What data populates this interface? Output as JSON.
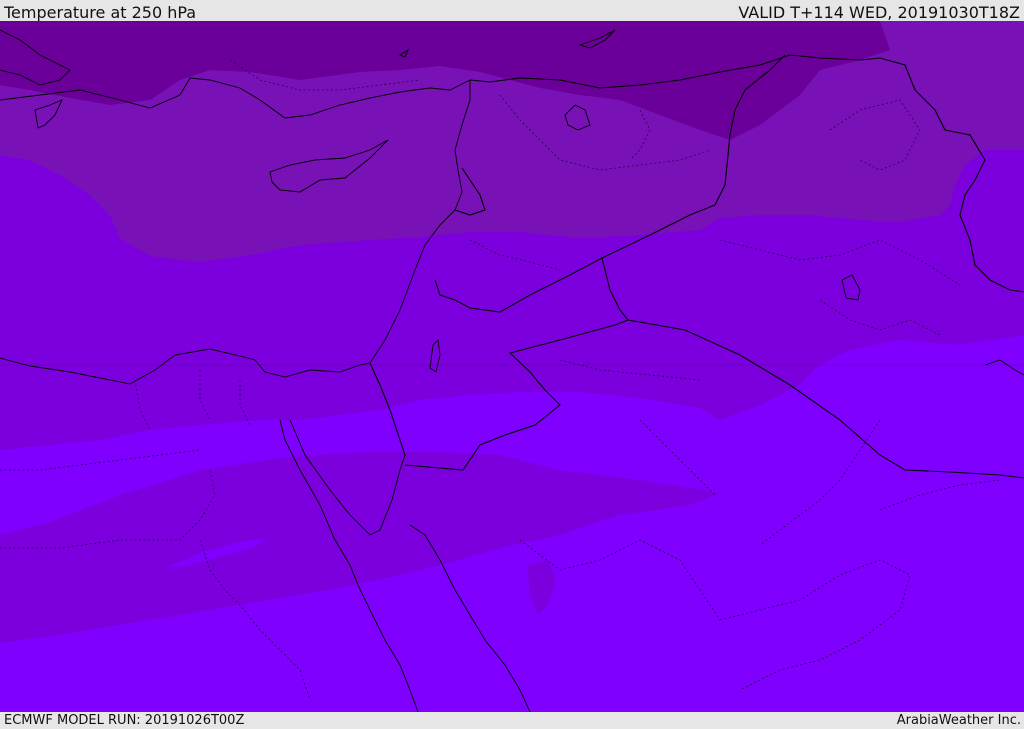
{
  "header": {
    "title": "Temperature at 250 hPa",
    "valid_label": "VALID T+114 WED, 20191030T18Z"
  },
  "footer": {
    "model_run": "ECMWF MODEL RUN: 20191026T00Z",
    "credit": "ArabiaWeather Inc."
  },
  "map": {
    "field": "temperature",
    "level": "250 hPa",
    "colors": {
      "band_coldest": "#6a0099",
      "band_cold": "#7812b6",
      "band_mid": "#7c00dd",
      "band_warm": "#7f00ff",
      "country_border": "#000000",
      "admin_border": "#2a0055",
      "coastline": "#000000"
    }
  }
}
